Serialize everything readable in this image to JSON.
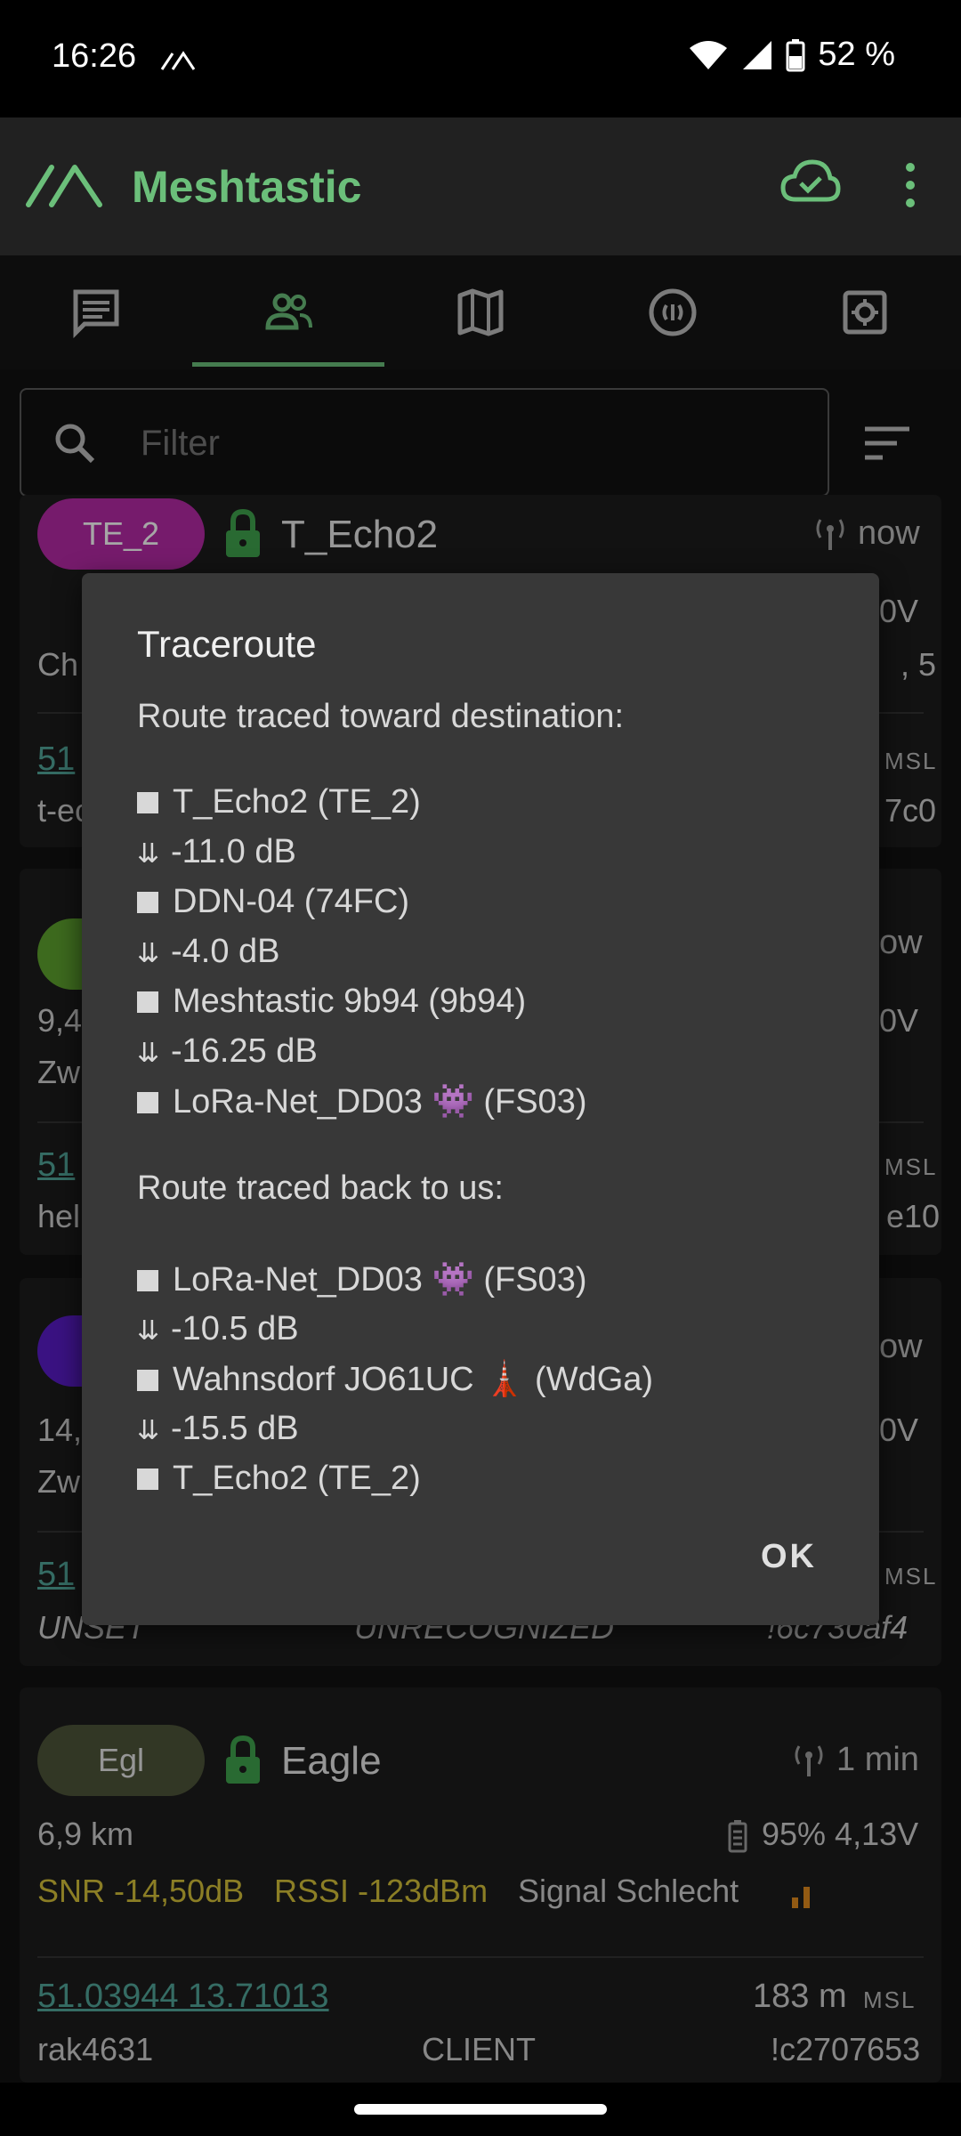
{
  "status_bar": {
    "time": "16:26",
    "battery": "52 %"
  },
  "app_bar": {
    "title": "Meshtastic",
    "accent": "#6bbf7a"
  },
  "tabs": [
    {
      "icon": "chat-icon"
    },
    {
      "icon": "nodes-icon",
      "active": true
    },
    {
      "icon": "map-icon"
    },
    {
      "icon": "channel-icon"
    },
    {
      "icon": "settings-icon"
    }
  ],
  "filter": {
    "placeholder": "Filter"
  },
  "nodes": [
    {
      "chip": "TE_2",
      "chip_color": "#b52aa6",
      "name": "T_Echo2",
      "age": "now",
      "voltage_partial": "0V",
      "info_partial": "Ch",
      "info_right_partial": ", 5",
      "coords_partial": "51",
      "alt_suffix": "MSL",
      "hw_partial": "t-ec",
      "id_partial": "7c0"
    },
    {
      "chip_color": "#5fa32e",
      "age": "ow",
      "distance_partial": "9,4",
      "voltage_partial": "0V",
      "info_partial": "Zw",
      "coords_partial": "51",
      "alt_suffix": "MSL",
      "hw_partial": "hel",
      "id_partial": "e10"
    },
    {
      "chip_color": "#5a1dc8",
      "age": "ow",
      "distance_partial": "14,",
      "voltage_partial": "0V",
      "info_partial": "Zw",
      "coords_partial": "51",
      "alt_suffix": "MSL",
      "hw_partial": "UNSET",
      "role_partial": "UNRECOGNIZED",
      "id_partial": "!6c730af4"
    },
    {
      "chip": "Egl",
      "chip_color": "#4e5539",
      "name": "Eagle",
      "age": "1 min",
      "distance": "6,9 km",
      "battery": "95% 4,13V",
      "snr": "SNR -14,50dB",
      "rssi": "RSSI -123dBm",
      "signal": "Signal Schlecht",
      "coords": "51.03944 13.71013",
      "altitude": "183 m",
      "alt_suffix": "MSL",
      "hardware": "rak4631",
      "role": "CLIENT",
      "id": "!c2707653"
    }
  ],
  "dialog": {
    "title": "Traceroute",
    "toward_heading": "Route traced toward destination:",
    "toward": [
      {
        "kind": "node",
        "text": "T_Echo2 (TE_2)"
      },
      {
        "kind": "snr",
        "text": "-11.0 dB"
      },
      {
        "kind": "node",
        "text": "DDN-04 (74FC)"
      },
      {
        "kind": "snr",
        "text": "-4.0 dB"
      },
      {
        "kind": "node",
        "text": "Meshtastic 9b94 (9b94)"
      },
      {
        "kind": "snr",
        "text": "-16.25 dB"
      },
      {
        "kind": "node",
        "text": "LoRa-Net_DD03 👾 (FS03)"
      }
    ],
    "back_heading": "Route traced back to us:",
    "back": [
      {
        "kind": "node",
        "text": "LoRa-Net_DD03 👾 (FS03)"
      },
      {
        "kind": "snr",
        "text": "-10.5 dB"
      },
      {
        "kind": "node",
        "text": "Wahnsdorf JO61UC 🗼 (WdGa)"
      },
      {
        "kind": "snr",
        "text": "-15.5 dB"
      },
      {
        "kind": "node",
        "text": "T_Echo2 (TE_2)"
      }
    ],
    "ok_label": "OK"
  },
  "colors": {
    "snr_text": "#d6c23a",
    "signal_bars": "#e08a1e",
    "link": "#52a79a"
  }
}
